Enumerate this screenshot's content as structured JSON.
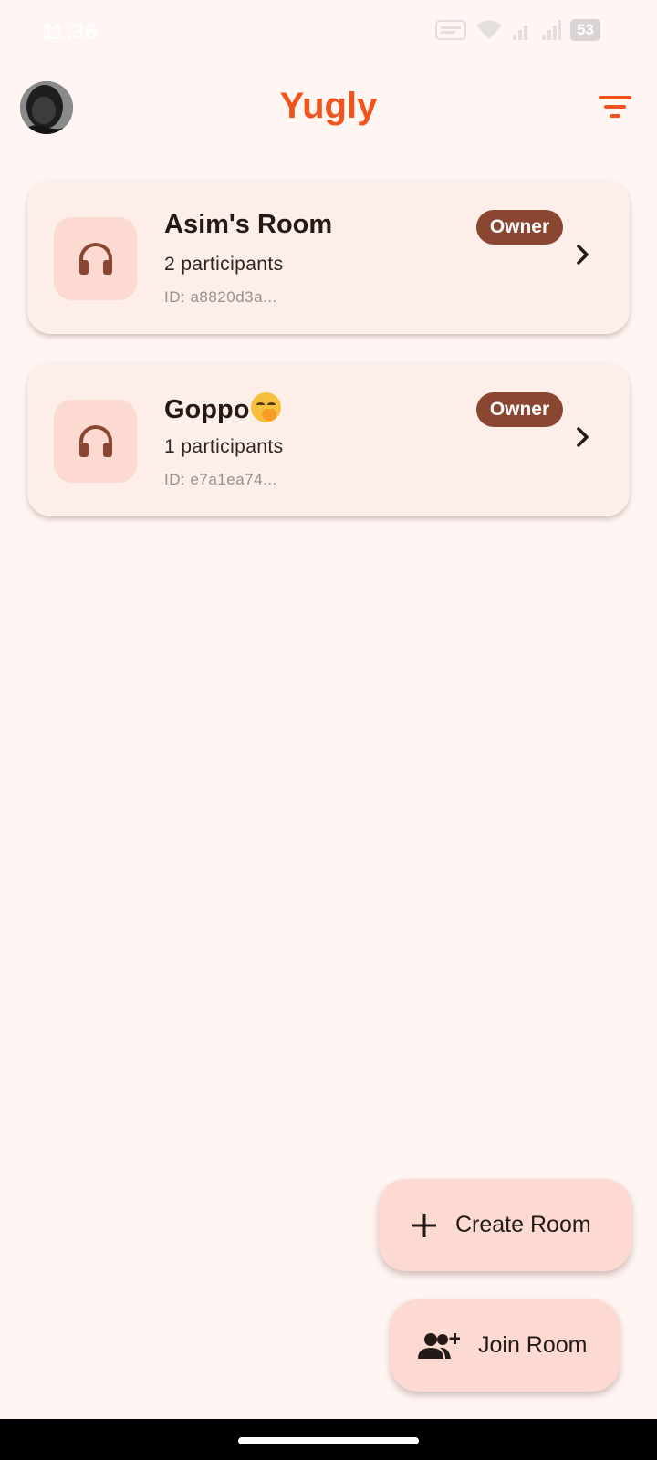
{
  "status_bar": {
    "time": "11:36",
    "battery": "53",
    "icons": [
      "volte-icon",
      "wifi-icon",
      "signal-icon",
      "signal-icon",
      "battery-icon"
    ]
  },
  "header": {
    "title": "Yugly",
    "title_color": "#f0531c",
    "icons": [
      "avatar",
      "filter-icon"
    ]
  },
  "rooms": [
    {
      "name": "Asim's Room",
      "participants": "2 participants",
      "id": "ID: a8820d3a...",
      "badge": "Owner",
      "icon": "headphones-icon"
    },
    {
      "name": "Goppo",
      "name_emoji": "face-with-hand-over-mouth-emoji",
      "participants": "1 participants",
      "id": "ID: e7a1ea74...",
      "badge": "Owner",
      "icon": "headphones-icon"
    }
  ],
  "actions": {
    "create_label": "Create Room",
    "create_icon": "plus-icon",
    "join_label": "Join Room",
    "join_icon": "person-add-icon"
  },
  "colors": {
    "background": "#fff5f3",
    "card": "#fdeeea",
    "icon_tile": "#fcdad1",
    "badge": "#8b4632",
    "accent": "#f0531c"
  }
}
